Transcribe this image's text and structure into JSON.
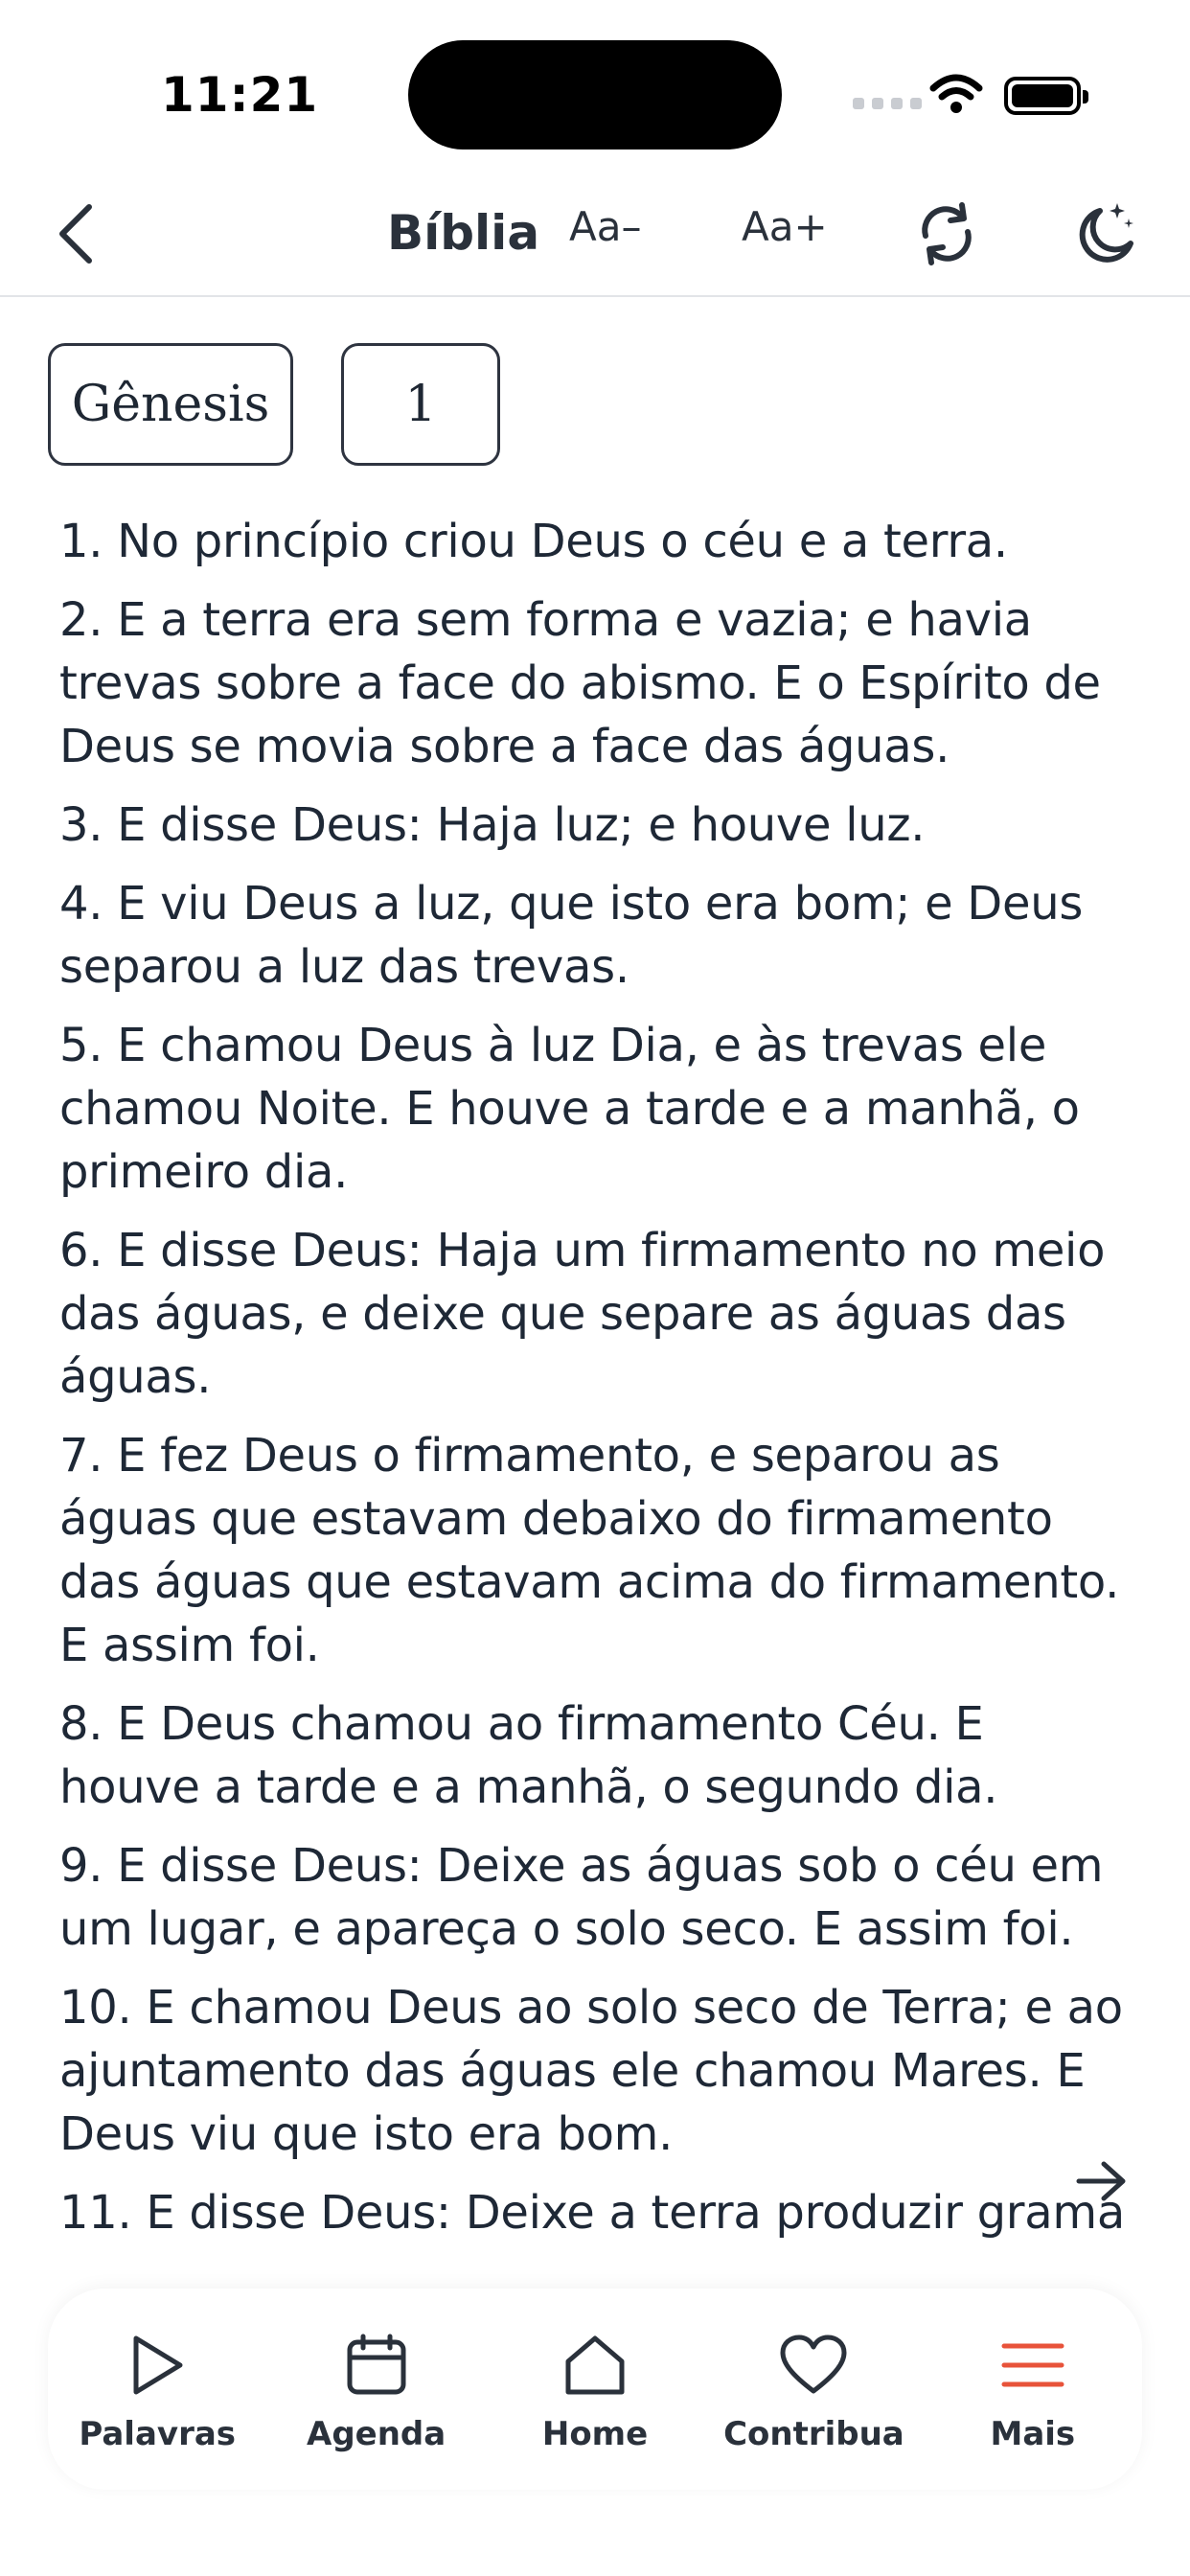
{
  "status_bar": {
    "time": "11:21"
  },
  "nav": {
    "title": "Bíblia",
    "font_decrease": "Aa–",
    "font_increase": "Aa+",
    "icons": [
      "chevron-left-icon",
      "refresh-icon",
      "moon-stars-icon"
    ]
  },
  "selectors": {
    "book": "Gênesis",
    "chapter": "1"
  },
  "verses": [
    "1. No princípio criou Deus o céu e a terra.",
    "2. E a terra era sem forma e vazia; e havia trevas sobre a face do abismo. E o Espírito de Deus se movia sobre a face das águas.",
    "3. E disse Deus: Haja luz; e houve luz.",
    "4. E viu Deus a luz, que isto era bom; e Deus separou a luz das trevas.",
    "5. E chamou Deus à luz Dia, e às trevas ele chamou Noite. E houve a tarde e a manhã, o primeiro dia.",
    "6. E disse Deus: Haja um firmamento no meio das águas, e deixe que separe as águas das águas.",
    "7. E fez Deus o firmamento, e separou as águas que estavam debaixo do firmamento das águas que estavam acima do firmamento. E assim foi.",
    "8. E Deus chamou ao firmamento Céu. E houve a tarde e a manhã, o segundo dia.",
    "9. E disse Deus: Deixe as águas sob o céu em um lugar, e apareça o solo seco. E assim foi.",
    "10. E chamou Deus ao solo seco de Terra; e ao ajuntamento das águas ele chamou Mares. E Deus viu que isto era bom.",
    "11. E disse Deus: Deixe a terra produzir grama"
  ],
  "tabbar": {
    "items": [
      {
        "label": "Palavras",
        "icon": "play-icon"
      },
      {
        "label": "Agenda",
        "icon": "calendar-icon"
      },
      {
        "label": "Home",
        "icon": "home-icon"
      },
      {
        "label": "Contribua",
        "icon": "heart-icon"
      },
      {
        "label": "Mais",
        "icon": "menu-icon"
      }
    ],
    "active_color": "#e8533a"
  }
}
